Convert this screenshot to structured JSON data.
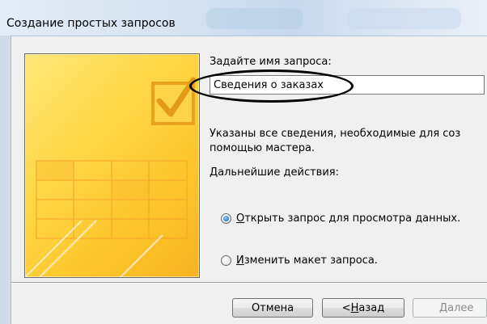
{
  "window": {
    "title": "Создание простых запросов"
  },
  "form": {
    "prompt_label": "Задайте имя запроса:",
    "query_name_value": "Сведения о заказах",
    "info_line1": "Указаны все сведения, необходимые для соз",
    "info_line2": "помощью мастера.",
    "next_actions_label": "Дальнейшие действия:"
  },
  "options": [
    {
      "hotkey": "О",
      "rest": "ткрыть запрос для просмотра данных.",
      "checked": true
    },
    {
      "hotkey": "И",
      "rest": "зменить макет запроса.",
      "checked": false
    }
  ],
  "buttons": {
    "cancel": "Отмена",
    "back_prefix": "< ",
    "back_hotkey": "Н",
    "back_rest": "азад",
    "next": "Далее"
  },
  "colors": {
    "radio_selected": "#1f6fd1",
    "illustration": "#fcc62a"
  }
}
